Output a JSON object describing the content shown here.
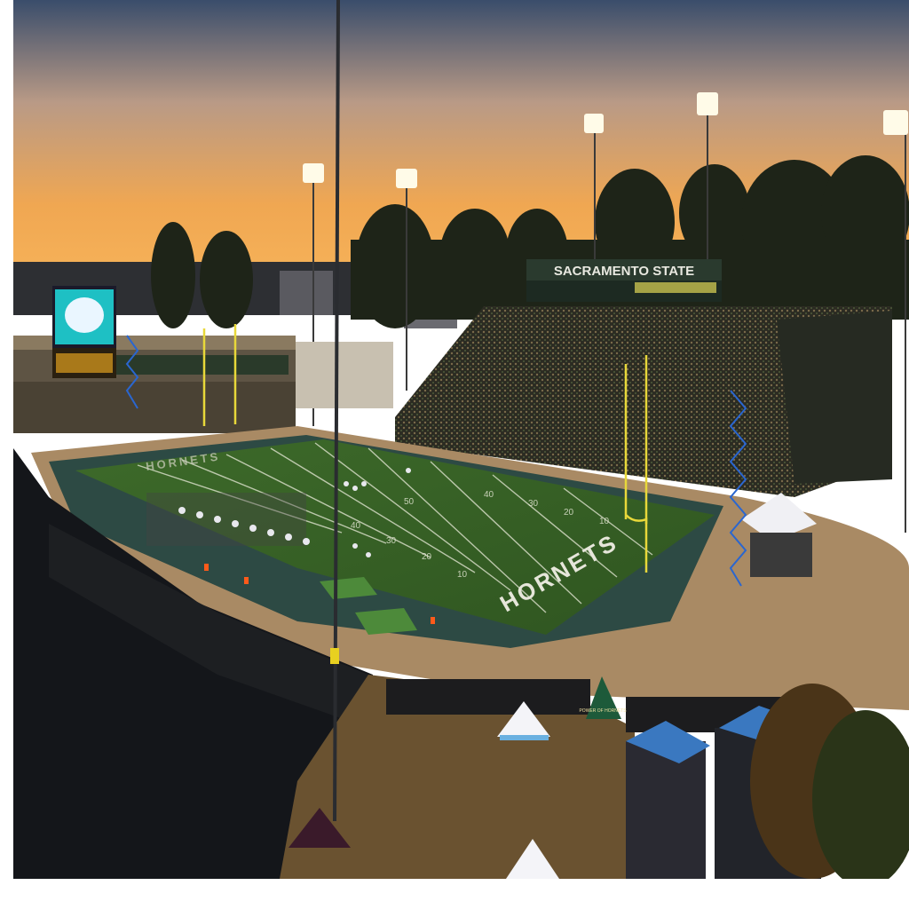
{
  "scene": {
    "banner_text": "SACRAMENTO STATE",
    "endzone_text": "HORNETS",
    "far_endzone_text": "HORNETS",
    "yard_numbers": [
      "10",
      "20",
      "30",
      "40",
      "50",
      "40",
      "30",
      "20",
      "10"
    ],
    "tent_sign_text": "POWER OF HORNETS"
  },
  "colors": {
    "sky_top": "#3a4f6e",
    "sky_mid": "#c9a27a",
    "sky_horizon": "#f2a64a",
    "field_green": "#3f6b2b",
    "track": "#b3906a",
    "scoreboard_teal": "#1ec0c4"
  }
}
